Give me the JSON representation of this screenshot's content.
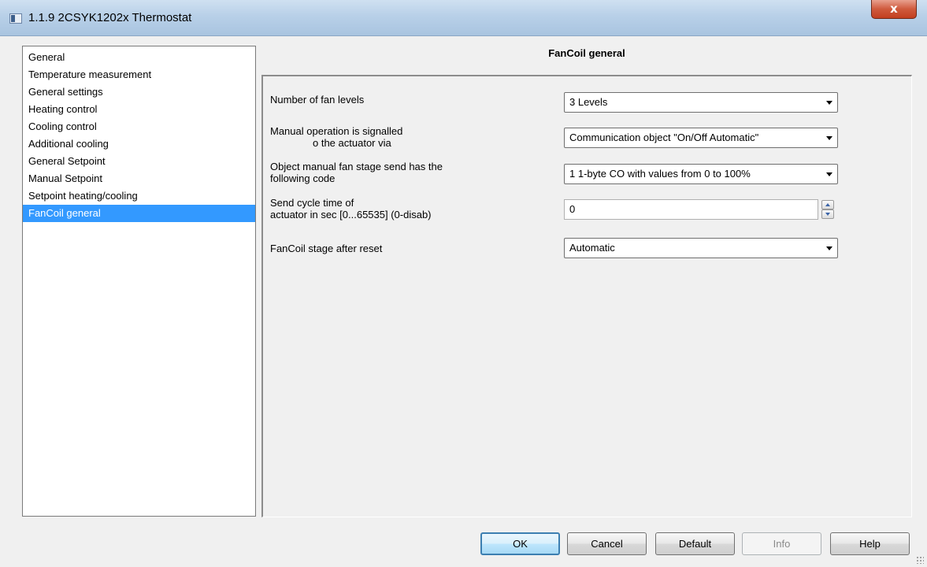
{
  "window": {
    "title": "1.1.9 2CSYK1202x Thermostat",
    "close_label": "x"
  },
  "nav": {
    "items": [
      {
        "label": "General"
      },
      {
        "label": "Temperature measurement"
      },
      {
        "label": "General settings"
      },
      {
        "label": "Heating control"
      },
      {
        "label": "Cooling control"
      },
      {
        "label": "Additional cooling"
      },
      {
        "label": "General Setpoint"
      },
      {
        "label": "Manual Setpoint"
      },
      {
        "label": "Setpoint heating/cooling"
      },
      {
        "label": "FanCoil general"
      }
    ],
    "selected": "FanCoil general"
  },
  "section": {
    "title": "FanCoil general"
  },
  "params": {
    "fan_levels": {
      "label": "Number of fan levels",
      "value": "3 Levels"
    },
    "manual_op": {
      "label_line1": "Manual operation is signalled",
      "label_line2": "o the actuator via",
      "value": "Communication object \"On/Off Automatic\""
    },
    "manual_fan_code": {
      "label_line1": "Object manual fan stage send has the",
      "label_line2": "following code",
      "value": "1 1-byte CO with values from 0 to 100%"
    },
    "send_cycle": {
      "label_line1": "Send cycle time of",
      "label_line2": "actuator in sec [0...65535] (0-disab)",
      "value": "0"
    },
    "stage_after_reset": {
      "label": "FanCoil stage after reset",
      "value": "Automatic"
    }
  },
  "buttons": {
    "ok": "OK",
    "cancel": "Cancel",
    "default": "Default",
    "info": "Info",
    "help": "Help"
  }
}
